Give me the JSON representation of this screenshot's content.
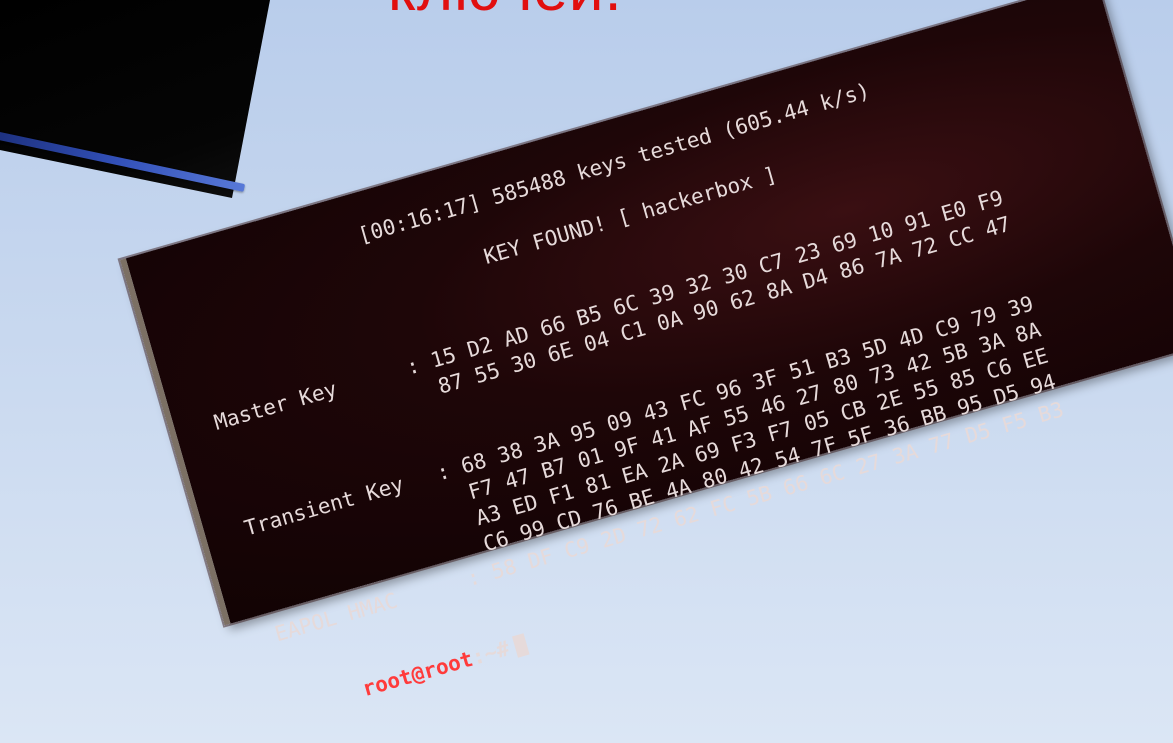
{
  "slide": {
    "title": "ключей."
  },
  "terminal": {
    "status_line": "[00:16:17] 585488 keys tested (605.44 k/s)",
    "key_found": "KEY FOUND! [ hackerbox ]",
    "master_key": {
      "label": "Master Key",
      "lines": [
        ": 15 D2 AD 66 B5 6C 39 32 30 C7 23 69 10 91 E0 F9",
        "  87 55 30 6E 04 C1 0A 90 62 8A D4 86 7A 72 CC 47"
      ]
    },
    "transient_key": {
      "label": "Transient Key",
      "lines": [
        ": 68 38 3A 95 09 43 FC 96 3F 51 B3 5D 4D C9 79 39",
        "  F7 47 B7 01 9F 41 AF 55 46 27 80 73 42 5B 3A 8A",
        "  A3 ED F1 81 EA 2A 69 F3 F7 05 CB 2E 55 85 C6 EE",
        "  C6 99 CD 76 BE 4A 80 42 54 7F 5F 36 BB 95 D5 94"
      ]
    },
    "eapol_hmac": {
      "label": "EAPOL HMAC",
      "line": ": 58 DF C9 2D 72 62 FC 5B 66 6C 27 3A 77 D5 F5 B3"
    },
    "prompt": {
      "user_host": "root@root",
      "path_suffix": ":~#"
    }
  },
  "colors": {
    "title": "#e10f0f",
    "terminal_bg": "#1e0608",
    "terminal_text": "#e6dada",
    "prompt_user": "#ff3b3b"
  }
}
